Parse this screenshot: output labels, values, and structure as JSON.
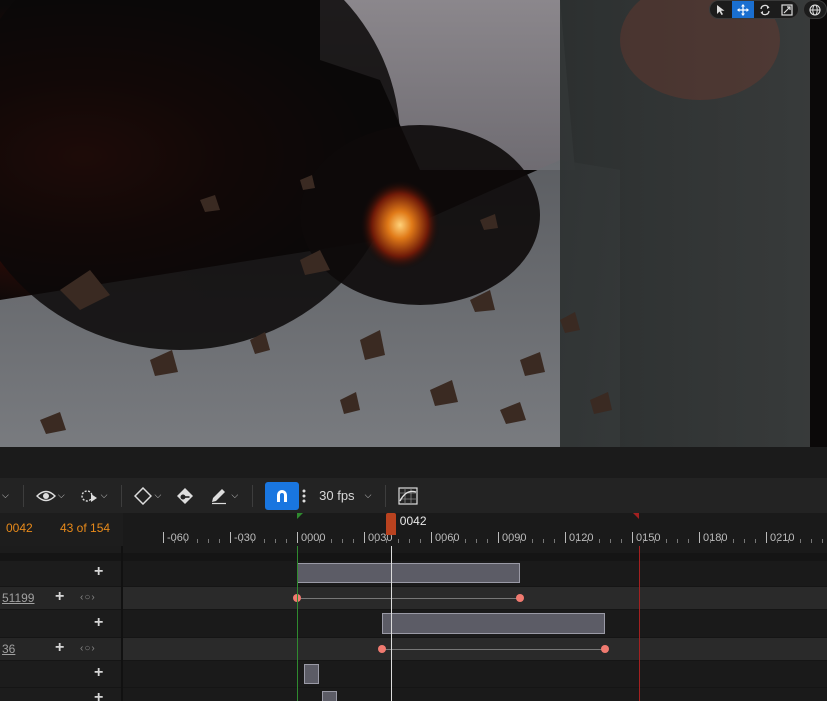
{
  "viewport": {
    "toolbar_icons": [
      "select-cursor-icon",
      "move-icon",
      "rotate-icon",
      "scale-icon",
      "globe-icon"
    ]
  },
  "toolbar": {
    "fps_label": "30 fps",
    "icons": [
      "eye-icon",
      "play-options-icon",
      "keyframe-diamond-icon",
      "auto-key-icon",
      "pencil-icon",
      "snap-magnet-icon",
      "more-vertical-icon",
      "curve-editor-icon"
    ]
  },
  "timeline": {
    "current_frame": "0042",
    "frame_count": "43 of 154",
    "playhead_label": "0042",
    "ticks": [
      "-060",
      "-030",
      "0000",
      "0030",
      "0060",
      "0090",
      "0120",
      "0150",
      "0180",
      "0210"
    ]
  },
  "tracks": [
    {
      "type": "section"
    },
    {
      "type": "property",
      "value": "51199"
    },
    {
      "type": "section"
    },
    {
      "type": "property",
      "value": "36"
    },
    {
      "type": "section"
    },
    {
      "type": "section"
    }
  ],
  "colors": {
    "accent": "#1976e0",
    "frame_text": "#e88a1a",
    "playhead": "#b9421f",
    "start_marker": "#2f8a2f",
    "end_marker": "#a32020",
    "keyframe": "#f07a70"
  }
}
